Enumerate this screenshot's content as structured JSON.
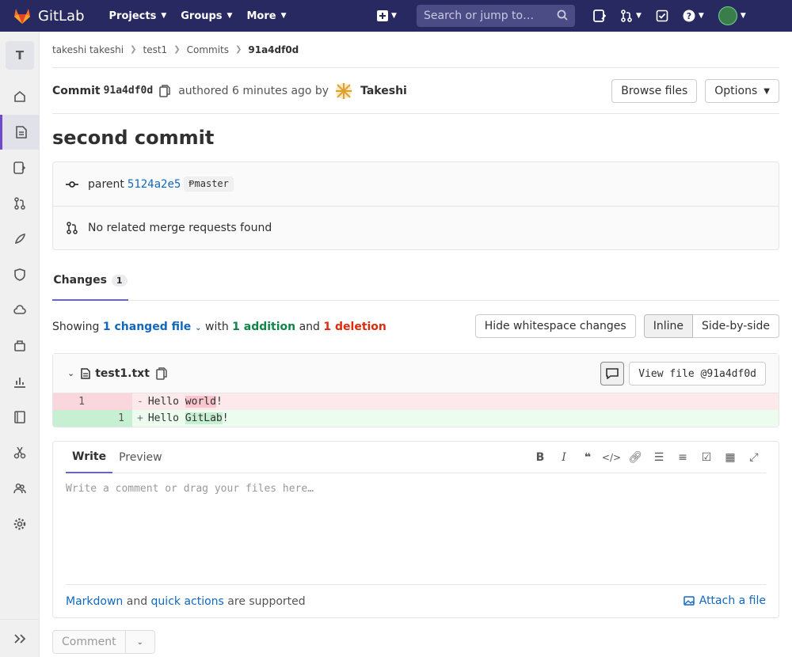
{
  "navbar": {
    "brand": "GitLab",
    "menu": [
      {
        "label": "Projects"
      },
      {
        "label": "Groups"
      },
      {
        "label": "More"
      }
    ],
    "search_placeholder": "Search or jump to…"
  },
  "sidebar": {
    "project_initial": "T"
  },
  "breadcrumb": {
    "items": [
      "takeshi takeshi",
      "test1",
      "Commits"
    ],
    "current": "91a4df0d"
  },
  "commit": {
    "label": "Commit",
    "sha": "91a4df0d",
    "authored": "authored 6 minutes ago by",
    "author": "Takeshi",
    "browse_files": "Browse files",
    "options": "Options",
    "title": "second commit",
    "parent_label": "parent",
    "parent_sha": "5124a2e5",
    "branch": "master",
    "merge_requests": "No related merge requests found"
  },
  "tabs": {
    "changes_label": "Changes",
    "changes_count": "1"
  },
  "diff_summary": {
    "showing": "Showing",
    "changed_files": "1 changed file",
    "with": "with",
    "additions": "1 addition",
    "and": "and",
    "deletions": "1 deletion",
    "hide_whitespace": "Hide whitespace changes",
    "inline": "Inline",
    "side_by_side": "Side-by-side"
  },
  "file": {
    "name": "test1.txt",
    "view_file": "View file @91a4df0d",
    "lines": [
      {
        "type": "del",
        "old": "1",
        "new": "",
        "sign": "-",
        "pre": "Hello ",
        "hl": "world",
        "post": "!"
      },
      {
        "type": "add",
        "old": "",
        "new": "1",
        "sign": "+",
        "pre": "Hello ",
        "hl": "GitLab",
        "post": "!"
      }
    ]
  },
  "editor": {
    "write_tab": "Write",
    "preview_tab": "Preview",
    "placeholder": "Write a comment or drag your files here…",
    "markdown": "Markdown",
    "and": "and",
    "quick_actions": "quick actions",
    "supported": "are supported",
    "attach": "Attach a file",
    "comment_button": "Comment"
  }
}
